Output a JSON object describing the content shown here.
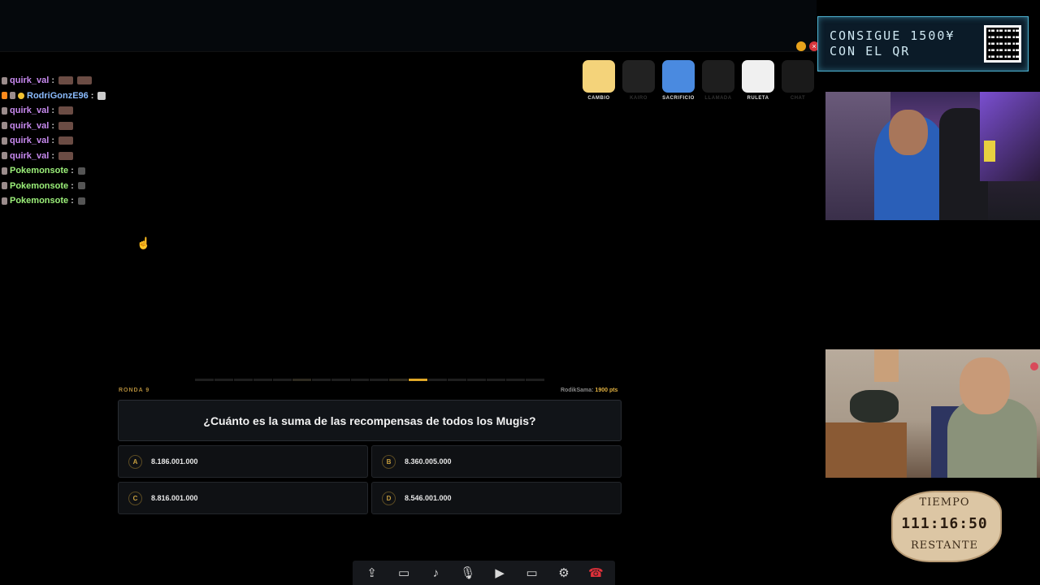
{
  "window": {
    "close_glyph": "×"
  },
  "qr_banner": {
    "line1": "CONSIGUE 1500¥",
    "line2": "CON EL QR"
  },
  "chat": [
    {
      "user": "quirk_val",
      "color": "purple",
      "badges": 1,
      "emotes": 2
    },
    {
      "user": "RodriGonzE96",
      "color": "blue",
      "badges": 3,
      "emotes": 1
    },
    {
      "user": "quirk_val",
      "color": "purple",
      "badges": 1,
      "emotes": 1
    },
    {
      "user": "quirk_val",
      "color": "purple",
      "badges": 1,
      "emotes": 1
    },
    {
      "user": "quirk_val",
      "color": "purple",
      "badges": 1,
      "emotes": 1
    },
    {
      "user": "quirk_val",
      "color": "purple",
      "badges": 1,
      "emotes": 1
    },
    {
      "user": "Pokemonsote",
      "color": "green",
      "badges": 1,
      "emotes": 1
    },
    {
      "user": "Pokemonsote",
      "color": "green",
      "badges": 1,
      "emotes": 1
    },
    {
      "user": "Pokemonsote",
      "color": "green",
      "badges": 1,
      "emotes": 1
    }
  ],
  "rewards": [
    {
      "label": "CAMBIO",
      "active": true,
      "color": "#f4d37a"
    },
    {
      "label": "KAIRO",
      "active": false,
      "color": "#888888"
    },
    {
      "label": "SACRIFICIO",
      "active": true,
      "color": "#4a8ae0"
    },
    {
      "label": "LLAMADA",
      "active": false,
      "color": "#777777"
    },
    {
      "label": "RULETA",
      "active": true,
      "color": "#f0f0f0"
    },
    {
      "label": "CHAT",
      "active": false,
      "color": "#666666"
    }
  ],
  "quiz": {
    "round": "RONDA 9",
    "score_user": "RodikSama:",
    "score_value": "1900 pts",
    "progress_total": 18,
    "progress_done": [
      5,
      10
    ],
    "progress_active": 11,
    "question": "¿Cuánto es la suma de las recompensas de todos los Mugis?",
    "answers": [
      {
        "letter": "A",
        "text": "8.186.001.000"
      },
      {
        "letter": "B",
        "text": "8.360.005.000"
      },
      {
        "letter": "C",
        "text": "8.816.001.000"
      },
      {
        "letter": "D",
        "text": "8.546.001.000"
      }
    ]
  },
  "timer": {
    "top": "TIEMPO",
    "value": "111:16:50",
    "bottom": "RESTANTE"
  },
  "toolbar": [
    {
      "name": "share-file-button",
      "glyph": "⇪"
    },
    {
      "name": "chat-button",
      "glyph": "▭"
    },
    {
      "name": "speaker-button",
      "glyph": "♪"
    },
    {
      "name": "microphone-button",
      "glyph": "🎙"
    },
    {
      "name": "camera-button",
      "glyph": "▶"
    },
    {
      "name": "screen-share-button",
      "glyph": "▭"
    },
    {
      "name": "settings-button",
      "glyph": "⚙"
    },
    {
      "name": "hang-up-button",
      "glyph": "☎",
      "red": true
    }
  ]
}
